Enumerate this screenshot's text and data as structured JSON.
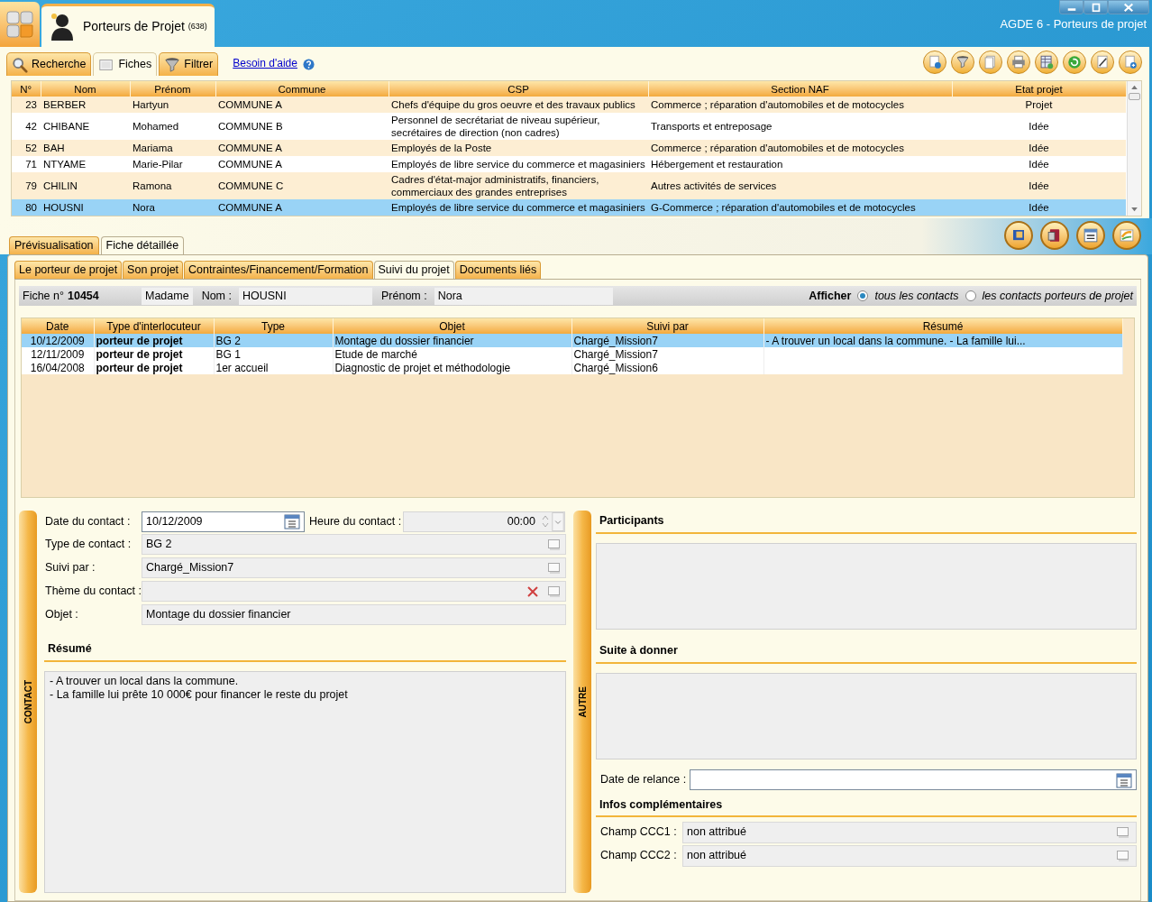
{
  "window": {
    "app_tab": {
      "title": "Porteurs de Projet",
      "count": "(638)"
    },
    "title": "AGDE 6 - Porteurs de projet"
  },
  "main_tabs": [
    {
      "label": "Recherche",
      "selected": false
    },
    {
      "label": "Fiches",
      "selected": true
    },
    {
      "label": "Filtrer",
      "selected": false
    }
  ],
  "help_link": "Besoin d'aide",
  "table": {
    "columns": [
      "N°",
      "Nom",
      "Prénom",
      "Commune",
      "CSP",
      "Section NAF",
      "Etat projet"
    ],
    "rows": [
      {
        "cells": [
          "23",
          "BERBER",
          "Hartyun",
          "COMMUNE A",
          "Chefs d'équipe du gros oeuvre et des travaux publics",
          "Commerce ; réparation d'automobiles et de motocycles",
          "Projet"
        ],
        "selected": false
      },
      {
        "cells": [
          "42",
          "CHIBANE",
          "Mohamed",
          "COMMUNE B",
          "Personnel de secrétariat de niveau supérieur, secrétaires de direction (non cadres)",
          "Transports et entreposage",
          "Idée"
        ],
        "selected": false
      },
      {
        "cells": [
          "52",
          "BAH",
          "Mariama",
          "COMMUNE A",
          "Employés de la Poste",
          "Commerce ; réparation d'automobiles et de motocycles",
          "Idée"
        ],
        "selected": false
      },
      {
        "cells": [
          "71",
          "NTYAME",
          "Marie-Pilar",
          "COMMUNE A",
          "Employés de libre service du commerce et magasiniers",
          "Hébergement et restauration",
          "Idée"
        ],
        "selected": false
      },
      {
        "cells": [
          "79",
          "CHILIN",
          "Ramona",
          "COMMUNE C",
          "Cadres d'état-major administratifs, financiers, commerciaux des grandes entreprises",
          "Autres activités de services",
          "Idée"
        ],
        "selected": false
      },
      {
        "cells": [
          "80",
          "HOUSNI",
          "Nora",
          "COMMUNE A",
          "Employés de libre service du commerce et magasiniers",
          "G-Commerce ; réparation d'automobiles et de motocycles",
          "Idée"
        ],
        "selected": true
      }
    ]
  },
  "view_tabs": [
    {
      "label": "Prévisualisation",
      "selected": false
    },
    {
      "label": "Fiche détaillée",
      "selected": true
    }
  ],
  "detail_tabs": [
    {
      "label": "Le porteur de projet",
      "selected": false
    },
    {
      "label": "Son projet",
      "selected": false
    },
    {
      "label": "Contraintes/Financement/Formation",
      "selected": false
    },
    {
      "label": "Suivi du projet",
      "selected": true
    },
    {
      "label": "Documents liés",
      "selected": false
    }
  ],
  "record": {
    "fiche_label": "Fiche n°",
    "fiche_number": "10454",
    "civility": "Madame",
    "nom_label": "Nom :",
    "nom": "HOUSNI",
    "prenom_label": "Prénom :",
    "prenom": "Nora",
    "filter_label": "Afficher",
    "filter_options": [
      {
        "label": "tous les contacts",
        "selected": true
      },
      {
        "label": "les contacts porteurs de projet",
        "selected": false
      }
    ]
  },
  "contacts": {
    "columns": [
      "Date",
      "Type d'interlocuteur",
      "Type",
      "Objet",
      "Suivi par",
      "Résumé"
    ],
    "rows": [
      {
        "cells": [
          "10/12/2009",
          "porteur de projet",
          "BG 2",
          "Montage du dossier financier",
          "Chargé_Mission7",
          "- A trouver un local dans la commune.  - La famille lui..."
        ],
        "selected": true
      },
      {
        "cells": [
          "12/11/2009",
          "porteur de projet",
          "BG 1",
          "Etude de marché",
          "Chargé_Mission7"
        ],
        "selected": false
      },
      {
        "cells": [
          "16/04/2008",
          "porteur de projet",
          "1er accueil",
          "Diagnostic de projet et méthodologie",
          "Chargé_Mission6"
        ],
        "selected": false
      }
    ]
  },
  "contact_panel": {
    "side_label": "CONTACT",
    "date_field": {
      "label": "Date du contact :",
      "value": "10/12/2009"
    },
    "time_field": {
      "label": "Heure du contact :",
      "value": "00:00"
    },
    "lookups": [
      {
        "label": "Type de contact :",
        "value": "BG 2",
        "clearable": false
      },
      {
        "label": "Suivi par :",
        "value": "Chargé_Mission7",
        "clearable": false
      },
      {
        "label": "Thème du contact :",
        "clearable": true
      }
    ],
    "objet": {
      "label": "Objet :",
      "value": "Montage du dossier financier"
    },
    "resume_heading": "Résumé",
    "resume_lines": [
      "- A trouver un local dans la commune.",
      "- La famille lui prête 10 000€ pour financer le reste du projet"
    ]
  },
  "other_panel": {
    "side_label": "AUTRE",
    "participants_heading": "Participants",
    "suite_heading": "Suite à donner",
    "relance_label": "Date de relance :",
    "infos_heading": "Infos complémentaires",
    "extra_fields": [
      {
        "label": "Champ CCC1 :",
        "value": "non attribué"
      },
      {
        "label": "Champ CCC2 :",
        "value": "non attribué"
      }
    ]
  }
}
